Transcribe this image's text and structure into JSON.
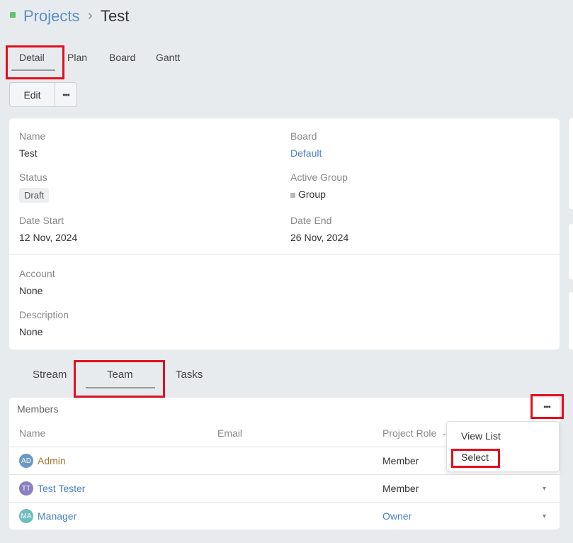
{
  "breadcrumb": {
    "parent": "Projects",
    "separator": "›",
    "current": "Test"
  },
  "top_tabs": [
    {
      "label": "Detail",
      "active": true
    },
    {
      "label": "Plan",
      "active": false
    },
    {
      "label": "Board",
      "active": false
    },
    {
      "label": "Gantt",
      "active": false
    }
  ],
  "actions": {
    "edit_label": "Edit",
    "more_label": "•••"
  },
  "detail": {
    "name_label": "Name",
    "name_value": "Test",
    "board_label": "Board",
    "board_value": "Default",
    "status_label": "Status",
    "status_value": "Draft",
    "active_group_label": "Active Group",
    "active_group_value": "Group",
    "date_start_label": "Date Start",
    "date_start_value": "12 Nov, 2024",
    "date_end_label": "Date End",
    "date_end_value": "26 Nov, 2024",
    "account_label": "Account",
    "account_value": "None",
    "description_label": "Description",
    "description_value": "None"
  },
  "bottom_tabs": [
    {
      "label": "Stream",
      "active": false
    },
    {
      "label": "Team",
      "active": true
    },
    {
      "label": "Tasks",
      "active": false
    }
  ],
  "members": {
    "title": "Members",
    "more_label": "•••",
    "columns": {
      "name": "Name",
      "email": "Email",
      "role": "Project Role"
    },
    "rows": [
      {
        "initials": "AD",
        "name": "Admin",
        "email": "",
        "role": "Member",
        "avatar_color": "#6a9ac4",
        "name_color": "#a0792a"
      },
      {
        "initials": "TT",
        "name": "Test Tester",
        "email": "",
        "role": "Member",
        "avatar_color": "#8a7fc0",
        "name_color": "#4a7fc0"
      },
      {
        "initials": "MA",
        "name": "Manager",
        "email": "",
        "role": "Owner",
        "avatar_color": "#6dbcc0",
        "name_color": "#4a7fc0"
      }
    ],
    "dropdown": {
      "items": [
        "View List",
        "Select"
      ]
    }
  },
  "colors": {
    "accent": "#4a7fc0",
    "highlight": "#e0101e",
    "status_dot": "#5cc56c"
  }
}
